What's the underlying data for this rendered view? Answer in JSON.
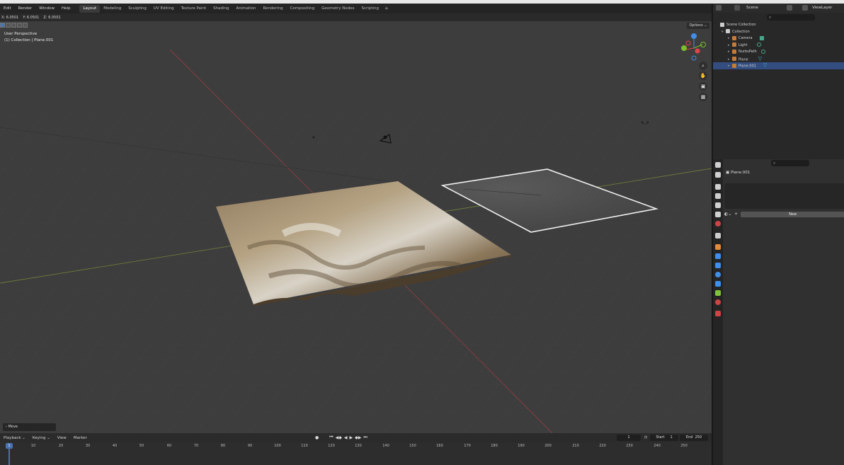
{
  "menu": {
    "items": [
      "Edit",
      "Render",
      "Window",
      "Help"
    ],
    "workspaces": [
      "Layout",
      "Modeling",
      "Sculpting",
      "UV Editing",
      "Texture Paint",
      "Shading",
      "Animation",
      "Rendering",
      "Compositing",
      "Geometry Nodes",
      "Scripting"
    ],
    "active_workspace": "Layout",
    "add_tab": "+"
  },
  "header2": {
    "x": "X: 6.0501",
    "y": "Y: 6.0501",
    "z": "Z: 6.0501"
  },
  "viewport": {
    "perspective": "User Perspective",
    "collection_info": "(1) Collection | Plane.001",
    "options_label": "Options ⌄",
    "move_panel": "› Move",
    "gizmo": {
      "x_color": "#e0434c",
      "y_color": "#7cbd2c",
      "z_color": "#3f8ee8"
    }
  },
  "outliner": {
    "scene_label": "Scene",
    "viewlayer_label": "ViewLayer",
    "search_glyph": "⌕",
    "rows": [
      {
        "label": "Scene Collection",
        "level": 0,
        "icon_color": "#cccccc"
      },
      {
        "label": "Collection",
        "level": 1,
        "icon_color": "#cccccc"
      },
      {
        "label": "Camera",
        "level": 2,
        "icon_color": "#c77b35",
        "mod_color": "#4aa58b"
      },
      {
        "label": "Light",
        "level": 2,
        "icon_color": "#c77b35",
        "mod_color": "#4aa58b"
      },
      {
        "label": "NurbsPath",
        "level": 2,
        "icon_color": "#c77b35",
        "mod_color": "#4aa58b"
      },
      {
        "label": "Plane",
        "level": 2,
        "icon_color": "#c77b35",
        "mod_color": "#3fb9d9"
      },
      {
        "label": "Plane.001",
        "level": 2,
        "icon_color": "#c77b35",
        "mod_color": "#3fb9d9",
        "selected": true
      }
    ]
  },
  "properties": {
    "object_name": "Plane.001",
    "new_button": "New",
    "add_button": "+",
    "search_glyph": "⌕",
    "tab_colors": [
      "#cfcfcf",
      "#cfcfcf",
      "#cfcfcf",
      "#cfcfcf",
      "#cfcfcf",
      "#c44",
      "#ccc",
      "#e08a3a",
      "#3f8ee8",
      "#3f8ee8",
      "#3f8ee8",
      "#3f8ee8",
      "#7ec33f",
      "#c44",
      "#c44"
    ]
  },
  "timeline": {
    "menus": [
      "Playback ⌄",
      "Keying ⌄",
      "View",
      "Marker"
    ],
    "current_frame": "1",
    "start_label": "Start",
    "start_value": "1",
    "end_label": "End",
    "end_value": "250",
    "frame_box": "1",
    "ticks": [
      "10",
      "20",
      "30",
      "40",
      "50",
      "60",
      "70",
      "80",
      "90",
      "100",
      "110",
      "120",
      "130",
      "140",
      "150",
      "160",
      "170",
      "180",
      "190",
      "200",
      "210",
      "220",
      "230",
      "240",
      "250"
    ]
  }
}
